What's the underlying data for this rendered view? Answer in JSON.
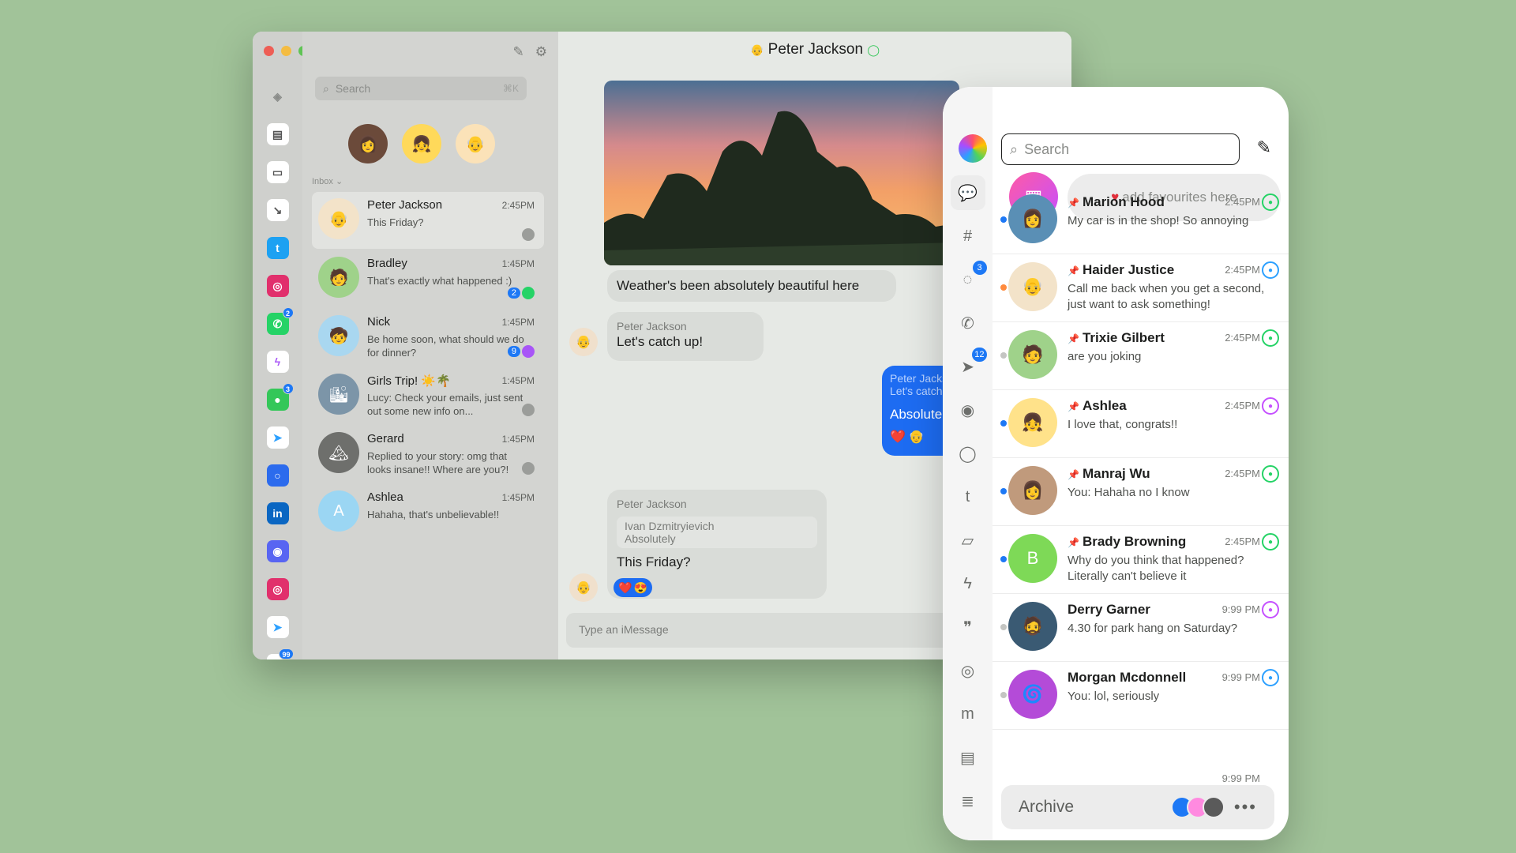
{
  "desktop": {
    "search": {
      "placeholder": "Search",
      "shortcut": "⌘K"
    },
    "inbox_label": "Inbox ⌄",
    "conversations": [
      {
        "name": "Peter Jackson",
        "time": "2:45PM",
        "preview": "This Friday?",
        "avatar": "#f3e3c9",
        "emoji": "👴",
        "app_color": "#9b9d9a"
      },
      {
        "name": "Bradley",
        "time": "1:45PM",
        "preview": "That's exactly what happened :)",
        "avatar": "#9fd28a",
        "emoji": "🧑",
        "count": "2",
        "app_color": "#25d366"
      },
      {
        "name": "Nick",
        "time": "1:45PM",
        "preview": "Be home soon, what should we do for dinner?",
        "avatar": "#a9d7f0",
        "emoji": "🧒",
        "count": "9",
        "app_color": "#a855f7"
      },
      {
        "name": "Girls Trip! ☀️🌴",
        "time": "1:45PM",
        "preview": "Lucy: Check your emails, just sent out some new info on...",
        "avatar": "#7c95a8",
        "emoji": "🏙",
        "app_color": "#9b9d9a"
      },
      {
        "name": "Gerard",
        "time": "1:45PM",
        "preview": "Replied to your story: omg that looks insane!! Where are you?!",
        "avatar": "#6e6f6c",
        "emoji": "🏔",
        "app_color": "#9b9d9a"
      },
      {
        "name": "Ashlea",
        "time": "1:45PM",
        "preview": "Hahaha, that's unbelievable!!",
        "avatar": "#9bd6f3",
        "emoji": "A"
      }
    ],
    "chat": {
      "title": "Peter Jackson",
      "message1": "Weather's been absolutely beautiful here",
      "message2_sender": "Peter Jackson",
      "message2_text": "Let's catch up!",
      "message3_sender": "Peter Jackso",
      "message3_quote": "Let's catch u",
      "message3_text": "Absolutely",
      "message4_sender": "Peter Jackson",
      "message4_quote_sender": "Ivan Dzmitryievich",
      "message4_quote_text": "Absolutely",
      "message4_text": "This Friday?",
      "composer_placeholder": "Type an  iMessage"
    },
    "rail_badges": {
      "whatsapp": "2",
      "imessage": "3",
      "slack": "99"
    }
  },
  "mobile": {
    "search": {
      "placeholder": "Search"
    },
    "add_favourites": "add favourites here",
    "rail_badges": {
      "signal": "3",
      "telegram": "12"
    },
    "conversations": [
      {
        "name": "Marion Hood",
        "time": "2:45PM",
        "preview": "My car is in the shop! So annoying",
        "avatar": "#5a8fb5",
        "emoji": "👩",
        "app_color": "#25d366",
        "dot": "#1d78f5"
      },
      {
        "name": "Haider Justice",
        "time": "2:45PM",
        "preview": "Call me back when you get a second, just want to ask something!",
        "avatar": "#f3e3c9",
        "emoji": "👴",
        "app_color": "#2ca0ff",
        "dot": "#ff8a3d"
      },
      {
        "name": "Trixie Gilbert",
        "time": "2:45PM",
        "preview": "are you joking",
        "avatar": "#9fd28a",
        "emoji": "🧑",
        "app_color": "#25d366",
        "dot": "#c4c5c2"
      },
      {
        "name": "Ashlea",
        "time": "2:45PM",
        "preview": "I love that, congrats!!",
        "avatar": "#ffe28a",
        "emoji": "👧",
        "app_color": "#c550ff",
        "dot": "#1d78f5"
      },
      {
        "name": "Manraj Wu",
        "time": "2:45PM",
        "preview": "You: Hahaha no I know",
        "avatar": "#c09a7c",
        "emoji": "👩",
        "app_color": "#25d366",
        "dot": "#1d78f5"
      },
      {
        "name": "Brady Browning",
        "time": "2:45PM",
        "preview": "Why do you think that happened? Literally can't believe it",
        "avatar": "#7ed957",
        "emoji": "B",
        "app_color": "#25d366",
        "dot": "#1d78f5"
      },
      {
        "name": "Derry Garner",
        "time": "9:99 PM",
        "preview": "4.30 for park hang on Saturday?",
        "avatar": "#3a5a73",
        "emoji": "🧔",
        "app_color": "#c550ff",
        "dot": "#c4c5c2"
      },
      {
        "name": "Morgan Mcdonnell",
        "time": "9:99 PM",
        "preview": "You: lol, seriously",
        "avatar": "#b44bd8",
        "emoji": "🌀",
        "app_color": "#2ca0ff",
        "dot": "#c4c5c2"
      }
    ],
    "archive_label": "Archive",
    "archive_partial_time": "9:99 PM"
  }
}
